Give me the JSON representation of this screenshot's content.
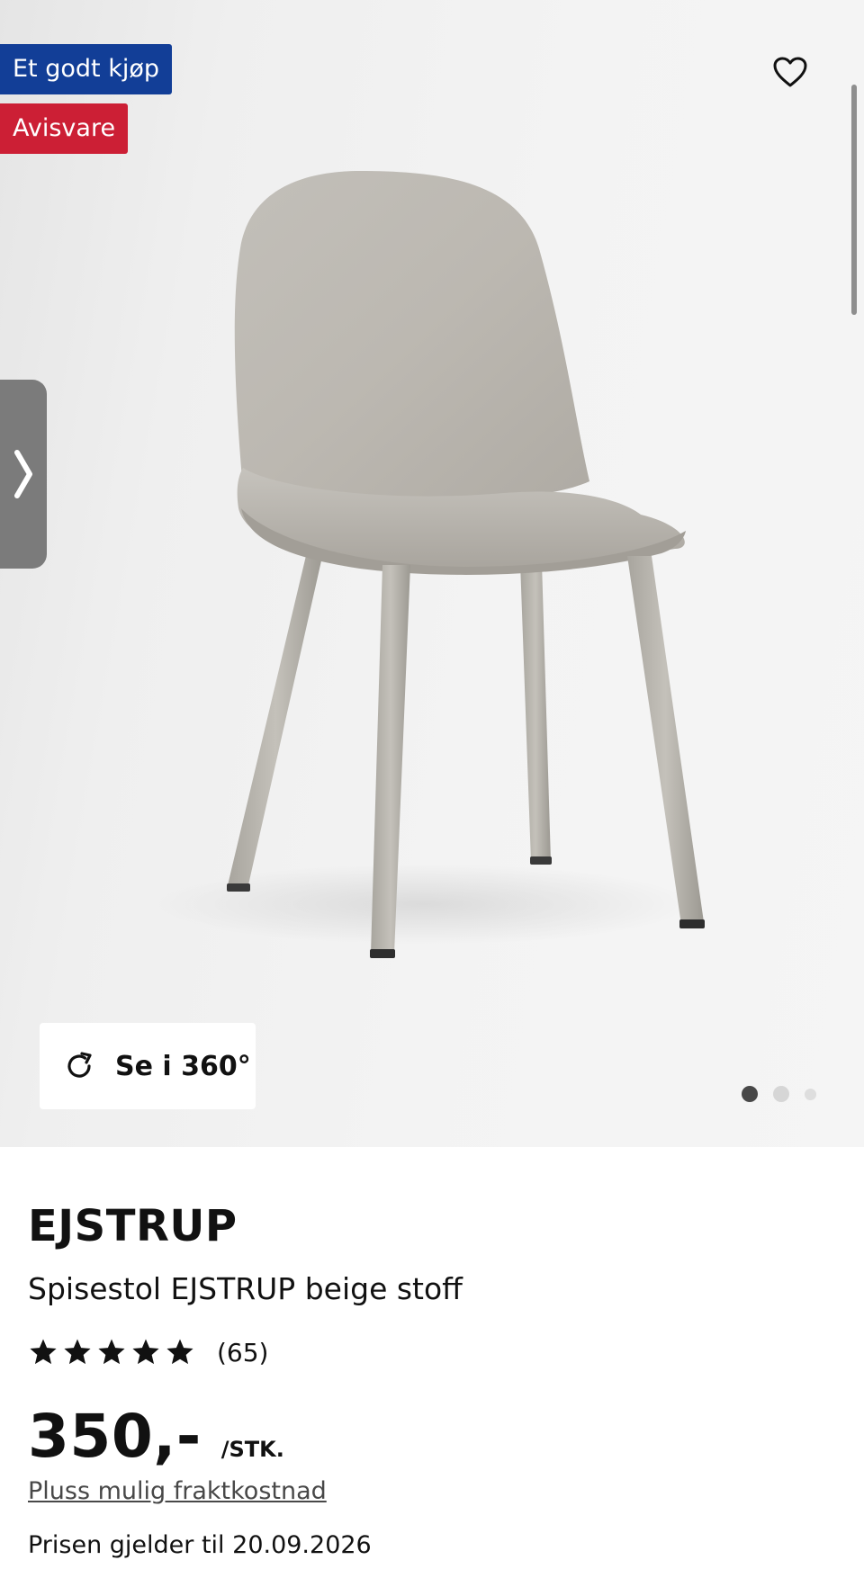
{
  "badges": {
    "deal": "Et godt kjøp",
    "ad": "Avisvare"
  },
  "gallery": {
    "view360_label": "Se i 360°",
    "slide_count": 3,
    "active_slide": 1
  },
  "icons": {
    "wishlist": "heart-icon",
    "next": "chevron-right-icon",
    "rotate": "rotate-icon",
    "rating": "star-icon"
  },
  "colors": {
    "deal_badge": "#123e97",
    "ad_badge": "#cc1f35",
    "text": "#111111",
    "link": "#484848"
  },
  "product": {
    "name": "EJSTRUP",
    "description": "Spisestol EJSTRUP beige stoff",
    "rating_stars": 5,
    "review_count": "(65)",
    "price": "350,-",
    "price_unit": "/STK.",
    "shipping_link": "Pluss mulig fraktkostnad",
    "price_valid": "Prisen gjelder til 20.09.2026"
  }
}
